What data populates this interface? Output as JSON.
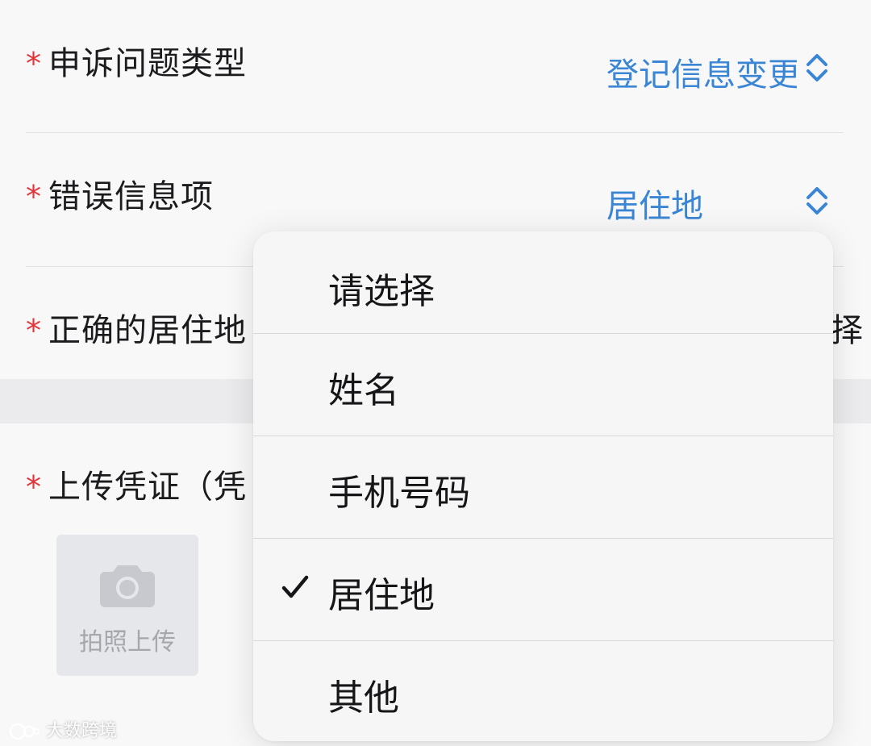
{
  "form": {
    "required_mark": "*",
    "complaint_type": {
      "label": "申诉问题类型",
      "value": "登记信息变更"
    },
    "error_item": {
      "label": "错误信息项",
      "value": "居住地"
    },
    "correct_address": {
      "label": "正确的居住地",
      "value_hint": "择"
    },
    "upload": {
      "label": "上传凭证（凭",
      "button_text": "拍照上传"
    }
  },
  "menu": {
    "options": [
      {
        "label": "请选择",
        "selected": false
      },
      {
        "label": "姓名",
        "selected": false
      },
      {
        "label": "手机号码",
        "selected": false
      },
      {
        "label": "居住地",
        "selected": true
      },
      {
        "label": "其他",
        "selected": false
      }
    ]
  },
  "watermark": {
    "text": "大数跨境"
  },
  "colors": {
    "accent": "#3a86d4",
    "required": "#e2353a",
    "text": "#1b1b1d"
  },
  "icons": {
    "updown": "chevron-up-down-icon",
    "camera": "camera-icon",
    "check": "checkmark-icon"
  }
}
